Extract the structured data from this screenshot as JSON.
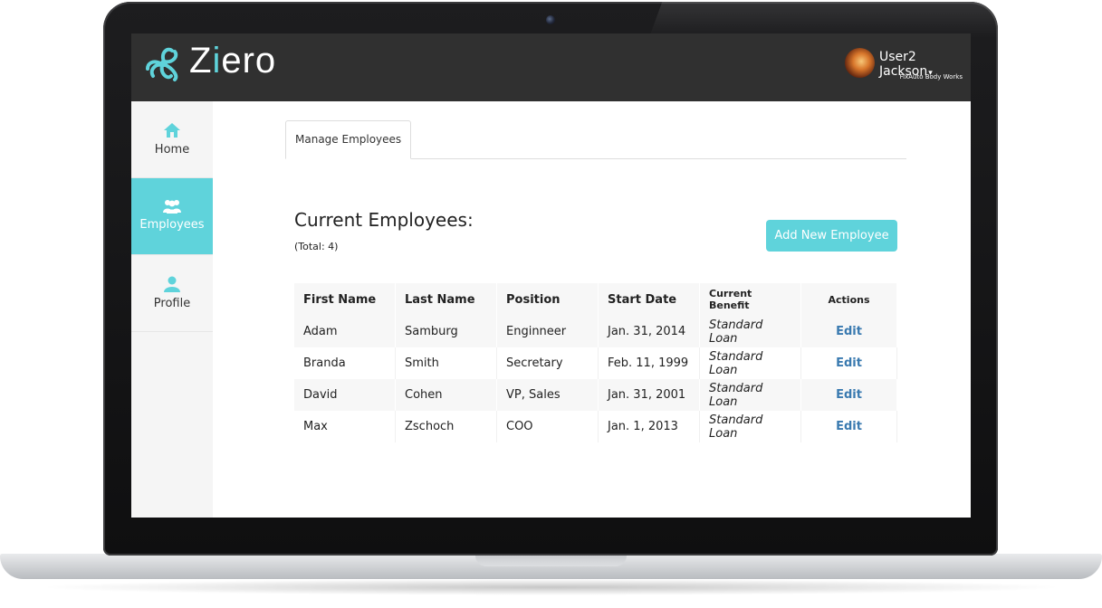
{
  "app": {
    "logo_text_start": "Z",
    "logo_text_accent": "i",
    "logo_text_end": "ero",
    "accent_color": "#5fd3db",
    "header_color": "#303030"
  },
  "user": {
    "name": "User2 Jackson",
    "caret": "▾",
    "company": "FixAuto Body Works"
  },
  "sidebar": {
    "items": [
      {
        "label": "Home",
        "icon": "home-icon",
        "active": false
      },
      {
        "label": "Employees",
        "icon": "users-icon",
        "active": true
      },
      {
        "label": "Profile",
        "icon": "user-icon",
        "active": false
      }
    ]
  },
  "tabs": [
    {
      "label": "Manage Employees"
    }
  ],
  "main": {
    "title": "Current Employees:",
    "total": "(Total: 4)",
    "add_button": "Add New Employee"
  },
  "table": {
    "headers": [
      "First Name",
      "Last Name",
      "Position",
      "Start Date",
      "Current Benefit",
      "Actions"
    ],
    "rows": [
      {
        "first": "Adam",
        "last": "Samburg",
        "position": "Enginneer",
        "start": "Jan. 31, 2014",
        "benefit": "Standard Loan",
        "action": "Edit"
      },
      {
        "first": "Branda",
        "last": "Smith",
        "position": "Secretary",
        "start": "Feb. 11, 1999",
        "benefit": "Standard Loan",
        "action": "Edit"
      },
      {
        "first": "David",
        "last": "Cohen",
        "position": "VP, Sales",
        "start": "Jan. 31, 2001",
        "benefit": "Standard Loan",
        "action": "Edit"
      },
      {
        "first": "Max",
        "last": "Zschoch",
        "position": "COO",
        "start": "Jan. 1, 2013",
        "benefit": "Standard Loan",
        "action": "Edit"
      }
    ]
  }
}
